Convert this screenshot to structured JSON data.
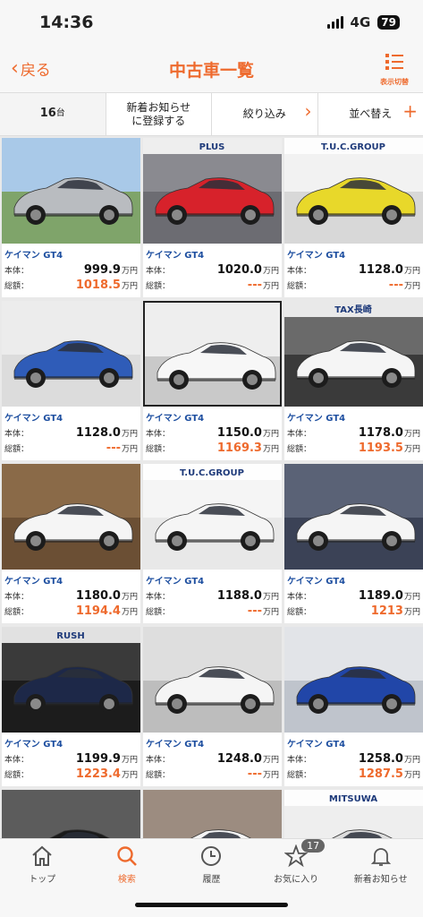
{
  "status": {
    "time": "14:36",
    "network": "4G",
    "battery": "79"
  },
  "nav": {
    "back_label": "戻る",
    "title": "中古車一覧",
    "display_toggle_label": "表示切替"
  },
  "filter": {
    "count": "16",
    "count_unit": "台",
    "register_line1": "新着お知らせ",
    "register_line2": "に登録する",
    "narrow_label": "絞り込み",
    "sort_label": "並べ替え"
  },
  "labels": {
    "body": "本体：",
    "total": "総額：",
    "unit": "万円"
  },
  "cars": [
    {
      "name": "ケイマン GT4",
      "price": "999.9",
      "total": "1018.5",
      "color": "#b9bcc0",
      "bg": "#7fa46a",
      "sky": "#a9c9e8",
      "brand": ""
    },
    {
      "name": "ケイマン GT4",
      "price": "1020.0",
      "total": "---",
      "color": "#d7222b",
      "bg": "#6c6c72",
      "sky": "#8a8a90",
      "brand": "PLUS"
    },
    {
      "name": "ケイマン GT4",
      "price": "1128.0",
      "total": "---",
      "color": "#e8d82a",
      "bg": "#d8d8d8",
      "sky": "#f2f2f2",
      "brand": "T.U.C.GROUP"
    },
    {
      "name": "ケイマン GT4",
      "price": "1128.0",
      "total": "---",
      "color": "#2f5cb8",
      "bg": "#dcdcdc",
      "sky": "#ececec",
      "brand": ""
    },
    {
      "name": "ケイマン GT4",
      "price": "1150.0",
      "total": "1169.3",
      "color": "#f7f7f7",
      "bg": "#c9c9c9",
      "sky": "#eeeeee",
      "brand": ""
    },
    {
      "name": "ケイマン GT4",
      "price": "1178.0",
      "total": "1193.5",
      "color": "#f5f5f5",
      "bg": "#3a3a3a",
      "sky": "#6a6a6a",
      "brand": "TAX長崎"
    },
    {
      "name": "ケイマン GT4",
      "price": "1180.0",
      "total": "1194.4",
      "color": "#f5f5f5",
      "bg": "#6b4f34",
      "sky": "#8a6a48",
      "brand": ""
    },
    {
      "name": "ケイマン GT4",
      "price": "1188.0",
      "total": "---",
      "color": "#f5f5f5",
      "bg": "#e8e8e8",
      "sky": "#f5f5f5",
      "brand": "T.U.C.GROUP"
    },
    {
      "name": "ケイマン GT4",
      "price": "1189.0",
      "total": "1213",
      "color": "#f5f5f5",
      "bg": "#3b4256",
      "sky": "#5a6276",
      "brand": ""
    },
    {
      "name": "ケイマン GT4",
      "price": "1199.9",
      "total": "1223.4",
      "color": "#1d2848",
      "bg": "#1c1c1c",
      "sky": "#3a3a3a",
      "brand": "RUSH"
    },
    {
      "name": "ケイマン GT4",
      "price": "1248.0",
      "total": "---",
      "color": "#f5f5f5",
      "bg": "#bdbdbd",
      "sky": "#dedede",
      "brand": ""
    },
    {
      "name": "ケイマン GT4",
      "price": "1258.0",
      "total": "1287.5",
      "color": "#2146a8",
      "bg": "#bfc4cc",
      "sky": "#e2e4e8",
      "brand": ""
    }
  ],
  "partial_cards": [
    {
      "color": "#1a1a1a",
      "bg": "#5c5c5c",
      "brand": ""
    },
    {
      "color": "#f5f5f5",
      "bg": "#9c8c80",
      "brand": ""
    },
    {
      "color": "#dddddd",
      "bg": "#eeeeee",
      "brand": "MITSUWA"
    }
  ],
  "tabs": [
    {
      "label": "トップ",
      "icon": "home-icon"
    },
    {
      "label": "検索",
      "icon": "search-icon"
    },
    {
      "label": "履歴",
      "icon": "clock-icon"
    },
    {
      "label": "お気に入り",
      "icon": "star-icon",
      "badge": "17"
    },
    {
      "label": "新着お知らせ",
      "icon": "bell-icon"
    }
  ],
  "colors": {
    "accent": "#ee6a2d",
    "link": "#1e4fa0"
  }
}
